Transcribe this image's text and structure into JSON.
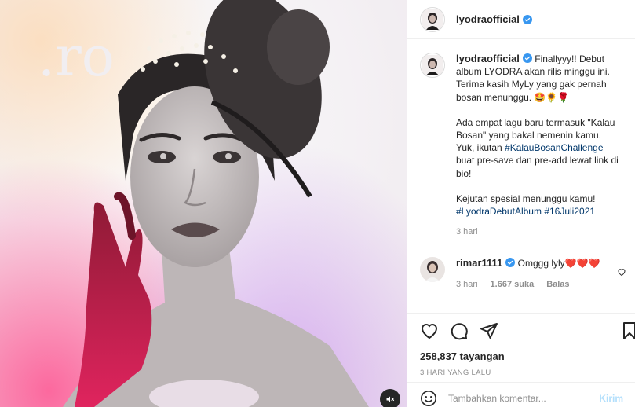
{
  "post": {
    "username": "lyodraofficial",
    "caption": {
      "p1_text": "Finallyyy!! Debut album LYODRA akan rilis minggu ini. Terima kasih MyLy yang gak pernah bosan menunggu. 🤩🌻🌹",
      "p2_text": "Ada empat lagu baru termasuk \"Kalau Bosan\" yang bakal nemenin kamu. Yuk, ikutan",
      "p2_hashtag": "#KalauBosanChallenge",
      "p2_tail": "buat pre-save dan pre-add lewat link di bio!",
      "p3_text": "Kejutan spesial menunggu kamu!",
      "p3_hashtag1": "#LyodraDebutAlbum",
      "p3_hashtag2": "#16Juli2021",
      "time": "3 hari"
    }
  },
  "comments": [
    {
      "username": "rimar1111",
      "text": "Omggg lyly❤️❤️❤️",
      "time": "3 hari",
      "likes": "1.667 suka",
      "reply_label": "Balas"
    }
  ],
  "stats": {
    "views": "258,837 tayangan",
    "date": "3 HARI YANG LALU"
  },
  "add_comment": {
    "placeholder": "Tambahkan komentar...",
    "send_label": "Kirim"
  },
  "icons": {
    "verified": "verified-badge-icon",
    "like": "heart-icon",
    "comment": "comment-icon",
    "share": "share-icon",
    "save": "bookmark-icon",
    "emoji": "emoji-icon",
    "mute": "speaker-muted-icon"
  },
  "colors": {
    "verified_blue": "#3897f0",
    "hashtag": "#00376b",
    "heart_red": "#ed4956"
  }
}
